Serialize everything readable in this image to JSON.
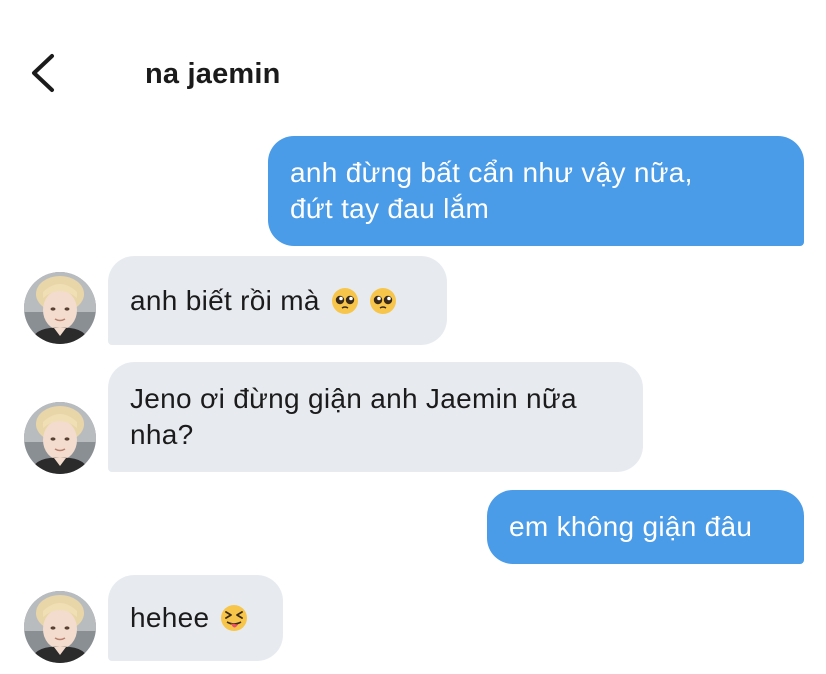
{
  "header": {
    "back_icon": "chevron-left-icon",
    "contact_name": "na jaemin"
  },
  "colors": {
    "outgoing_bubble": "#4a9be8",
    "incoming_bubble": "#e7ebf0",
    "text": "#1b1b1b"
  },
  "messages": [
    {
      "direction": "outgoing",
      "text": "anh đừng bất cẩn như vậy nữa,\nđứt tay đau lắm"
    },
    {
      "direction": "incoming",
      "text": "anh biết rồi mà",
      "emojis": [
        "pleading-face-icon",
        "pleading-face-icon"
      ]
    },
    {
      "direction": "incoming",
      "text": "Jeno ơi đừng giận anh Jaemin nữa\nnha?"
    },
    {
      "direction": "outgoing",
      "text": "em không giận đâu"
    },
    {
      "direction": "incoming",
      "text": "hehee",
      "emojis": [
        "squinting-tongue-face-icon"
      ]
    }
  ]
}
